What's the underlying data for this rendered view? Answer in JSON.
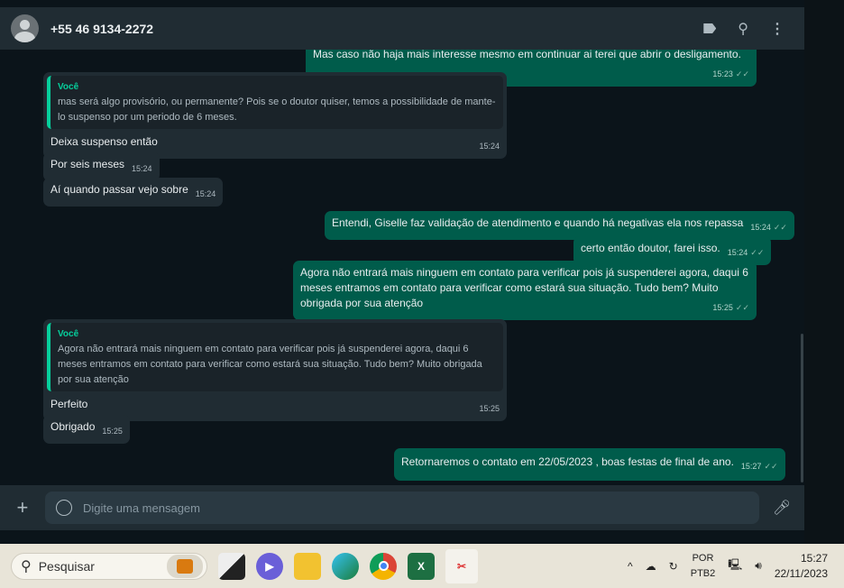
{
  "header": {
    "contact": "+55 46 9134-2272",
    "icons": [
      "label-icon",
      "search-icon",
      "menu-icon"
    ]
  },
  "messages": [
    {
      "dir": "out",
      "text": "Mas caso não haja mais interesse mesmo em continuar ai terei que abrir o desligamento.",
      "time": "15:23"
    },
    {
      "dir": "in",
      "quote_author": "Você",
      "quote": "mas será algo provisório, ou permanente? Pois se o doutor quiser, temos a possibilidade de mante-lo suspenso por um periodo de 6 meses.",
      "text": "Deixa suspenso então",
      "time": "15:24"
    },
    {
      "dir": "in",
      "text": "Por seis meses",
      "time": "15:24"
    },
    {
      "dir": "in",
      "text": "Aí quando passar vejo sobre",
      "time": "15:24"
    },
    {
      "dir": "out",
      "text": "Entendi, Giselle faz validação de atendimento e quando há negativas ela nos repassa",
      "time": "15:24"
    },
    {
      "dir": "out",
      "text": "certo então doutor, farei isso.",
      "time": "15:24"
    },
    {
      "dir": "out",
      "text": "Agora não entrará mais ninguem em contato para verificar pois já suspenderei agora, daqui 6 meses entramos em contato para verificar como estará sua situação. Tudo bem? Muito obrigada por sua atenção",
      "time": "15:25"
    },
    {
      "dir": "in",
      "quote_author": "Você",
      "quote": "Agora não entrará mais ninguem em contato para verificar pois já suspenderei agora, daqui 6 meses entramos em contato para verificar como estará sua situação. Tudo bem? Muito obrigada por sua atenção",
      "text": "Perfeito",
      "time": "15:25"
    },
    {
      "dir": "in",
      "text": "Obrigado",
      "time": "15:25"
    },
    {
      "dir": "out",
      "text": "Retornaremos o contato em 22/05/2023 , boas festas de final de ano.",
      "time": "15:27"
    }
  ],
  "composer": {
    "placeholder": "Digite uma mensagem"
  },
  "taskbar": {
    "search": "Pesquisar",
    "lang1": "POR",
    "lang2": "PTB2",
    "time": "15:27",
    "date": "22/11/2023"
  },
  "colors": {
    "outgoing": "#005c4b",
    "incoming": "#202c33",
    "accent": "#06cf9c"
  }
}
